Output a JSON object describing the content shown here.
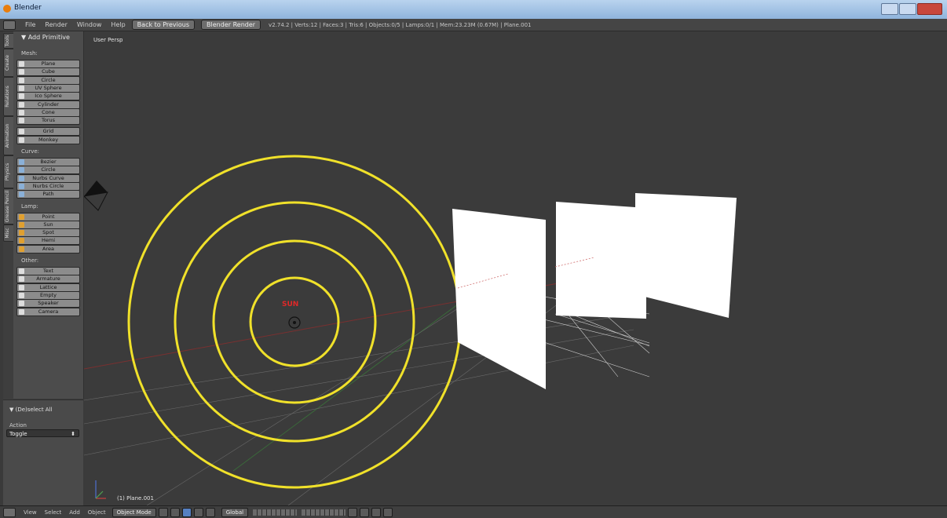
{
  "window": {
    "title": "Blender"
  },
  "info_bar": {
    "menus": [
      "File",
      "Render",
      "Window",
      "Help"
    ],
    "back_button": "Back to Previous",
    "render_engine": "Blender Render",
    "stats": "v2.74.2 | Verts:12 | Faces:3 | Tris:6 | Objects:0/5 | Lamps:0/1 | Mem:23.23M (0.67M) | Plane.001"
  },
  "side_tabs": [
    "Tools",
    "Create",
    "Relations",
    "Animation",
    "Physics",
    "Grease Pencil",
    "Misc"
  ],
  "tool_shelf": {
    "panel_title": "▼ Add Primitive",
    "sections": [
      {
        "label": "Mesh:",
        "buttons": [
          "Plane",
          "Cube",
          "Circle",
          "UV Sphere",
          "Ico Sphere",
          "Cylinder",
          "Cone",
          "Torus",
          "Grid",
          "Monkey"
        ]
      },
      {
        "label": "Curve:",
        "buttons": [
          "Bezier",
          "Circle",
          "Nurbs Curve",
          "Nurbs Circle",
          "Path"
        ]
      },
      {
        "label": "Lamp:",
        "buttons": [
          "Point",
          "Sun",
          "Spot",
          "Hemi",
          "Area"
        ]
      },
      {
        "label": "Other:",
        "buttons": [
          "Text",
          "Armature",
          "Lattice",
          "Empty",
          "Speaker",
          "Camera"
        ]
      }
    ]
  },
  "last_operator": {
    "title": "▼ (De)select All",
    "action_label": "Action",
    "action_value": "Toggle"
  },
  "viewport": {
    "view_label": "User Persp",
    "object_label": "(1) Plane.001",
    "sun_label": "SUN",
    "colors": {
      "background": "#3b3b3b",
      "sun_rings": "#f0e12a",
      "sun_label": "#e02828",
      "planes": "#ffffff"
    }
  },
  "header_3d": {
    "menus": [
      "View",
      "Select",
      "Add",
      "Object"
    ],
    "mode": "Object Mode",
    "orientation": "Global"
  }
}
